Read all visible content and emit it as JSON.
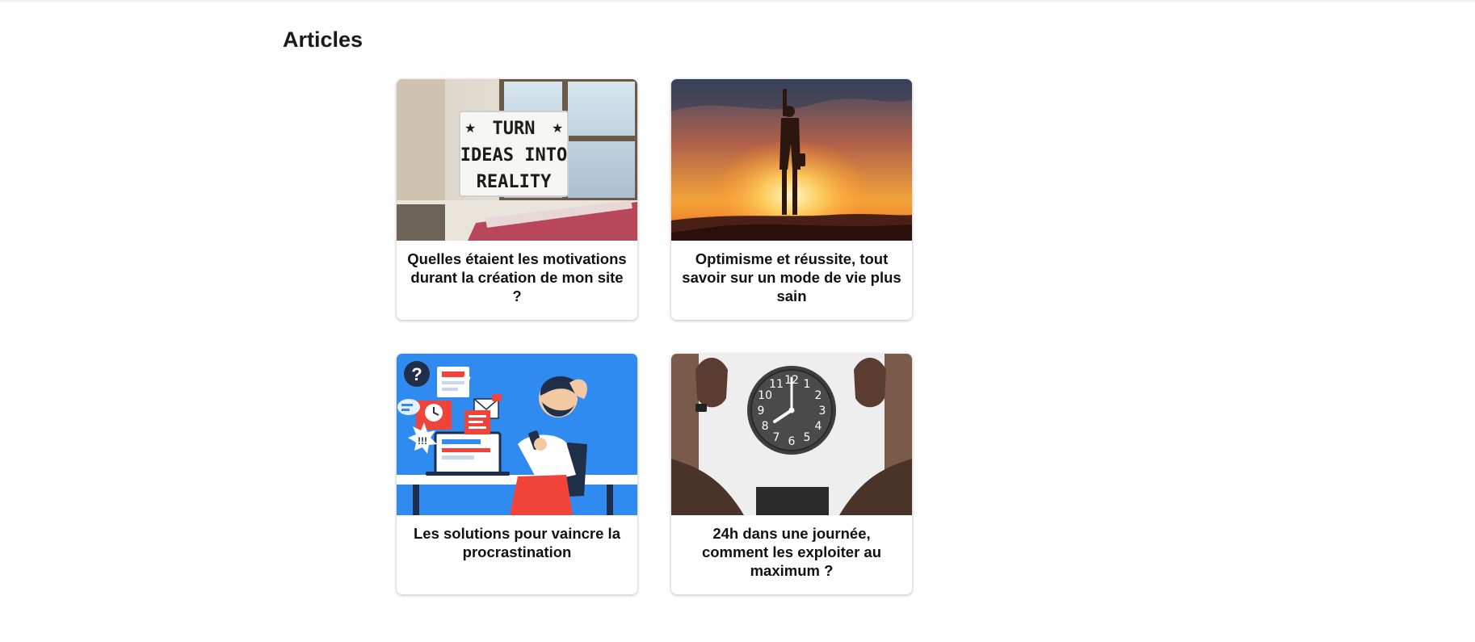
{
  "section": {
    "title": "Articles"
  },
  "articles": [
    {
      "title": "Quelles étaient les motivations durant la création de mon site ?",
      "image": {
        "icon": "lightbox-sign-illustration",
        "lines": [
          "TURN",
          "IDEAS INTO",
          "REALITY"
        ],
        "star": "★"
      }
    },
    {
      "title": "Optimisme et réussite, tout savoir sur un mode de vie plus sain",
      "image": {
        "icon": "sunset-success-silhouette-illustration"
      }
    },
    {
      "title": "Les solutions pour vaincre la procrastination",
      "image": {
        "icon": "procrastination-illustration",
        "question": "?",
        "alert": "!!!"
      }
    },
    {
      "title": "24h dans une journée, comment les exploiter au maximum ?",
      "image": {
        "icon": "wall-clock-illustration",
        "numbers": [
          "12",
          "1",
          "2",
          "3",
          "4",
          "5",
          "6",
          "7",
          "8",
          "9",
          "10",
          "11"
        ]
      }
    }
  ],
  "colors": {
    "illustration_blue": "#2f8bf0",
    "accent_red": "#f0443a",
    "heading": "#1a1a1a"
  }
}
